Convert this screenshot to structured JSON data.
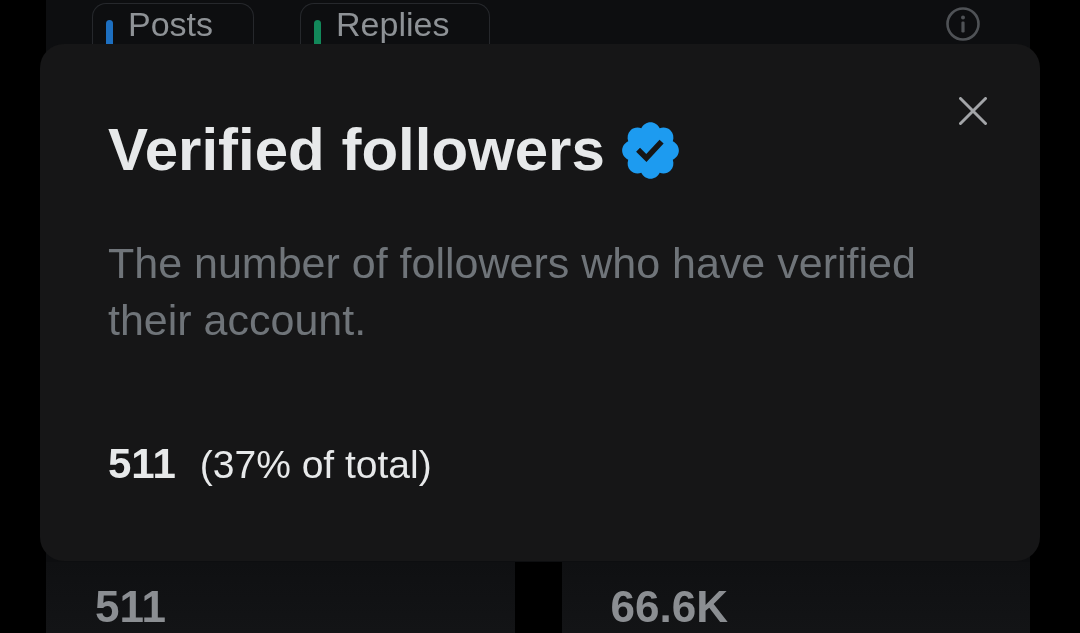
{
  "tabs": [
    {
      "label": "Posts",
      "color": "#1d6fc0"
    },
    {
      "label": "Replies",
      "color": "#12885a"
    }
  ],
  "modal": {
    "title": "Verified followers",
    "verified": true,
    "description": "The number of followers who have verified their account.",
    "value": "511",
    "share": "(37% of total)"
  },
  "cards": [
    {
      "value": "511"
    },
    {
      "value": "66.6K"
    }
  ]
}
